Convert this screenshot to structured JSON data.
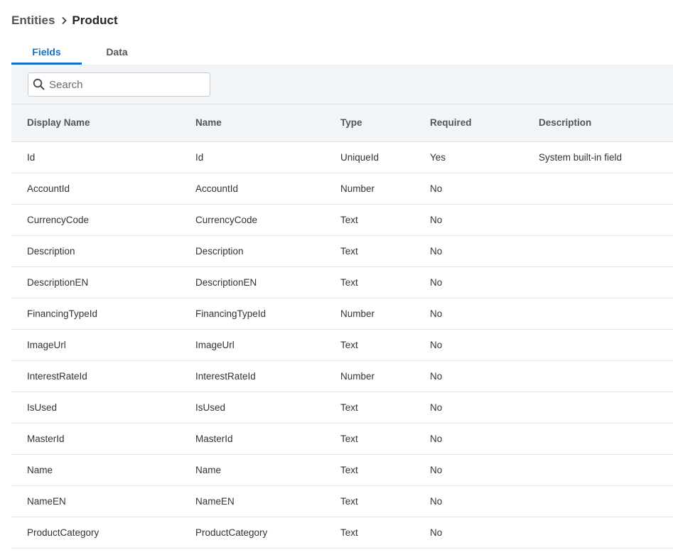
{
  "breadcrumb": {
    "parent": "Entities",
    "current": "Product"
  },
  "tabs": [
    {
      "label": "Fields",
      "active": true
    },
    {
      "label": "Data",
      "active": false
    }
  ],
  "search": {
    "placeholder": "Search",
    "value": ""
  },
  "table": {
    "columns": [
      "Display Name",
      "Name",
      "Type",
      "Required",
      "Description"
    ],
    "rows": [
      {
        "display_name": "Id",
        "name": "Id",
        "type": "UniqueId",
        "required": "Yes",
        "description": "System built-in field"
      },
      {
        "display_name": "AccountId",
        "name": "AccountId",
        "type": "Number",
        "required": "No",
        "description": ""
      },
      {
        "display_name": "CurrencyCode",
        "name": "CurrencyCode",
        "type": "Text",
        "required": "No",
        "description": ""
      },
      {
        "display_name": "Description",
        "name": "Description",
        "type": "Text",
        "required": "No",
        "description": ""
      },
      {
        "display_name": "DescriptionEN",
        "name": "DescriptionEN",
        "type": "Text",
        "required": "No",
        "description": ""
      },
      {
        "display_name": "FinancingTypeId",
        "name": "FinancingTypeId",
        "type": "Number",
        "required": "No",
        "description": ""
      },
      {
        "display_name": "ImageUrl",
        "name": "ImageUrl",
        "type": "Text",
        "required": "No",
        "description": ""
      },
      {
        "display_name": "InterestRateId",
        "name": "InterestRateId",
        "type": "Number",
        "required": "No",
        "description": ""
      },
      {
        "display_name": "IsUsed",
        "name": "IsUsed",
        "type": "Text",
        "required": "No",
        "description": ""
      },
      {
        "display_name": "MasterId",
        "name": "MasterId",
        "type": "Text",
        "required": "No",
        "description": ""
      },
      {
        "display_name": "Name",
        "name": "Name",
        "type": "Text",
        "required": "No",
        "description": ""
      },
      {
        "display_name": "NameEN",
        "name": "NameEN",
        "type": "Text",
        "required": "No",
        "description": ""
      },
      {
        "display_name": "ProductCategory",
        "name": "ProductCategory",
        "type": "Text",
        "required": "No",
        "description": ""
      }
    ]
  },
  "icons": {
    "breadcrumb_separator": "chevron-right-icon",
    "search": "search-icon"
  },
  "colors": {
    "accent": "#1570c9",
    "header_bg": "#f2f5f7"
  }
}
